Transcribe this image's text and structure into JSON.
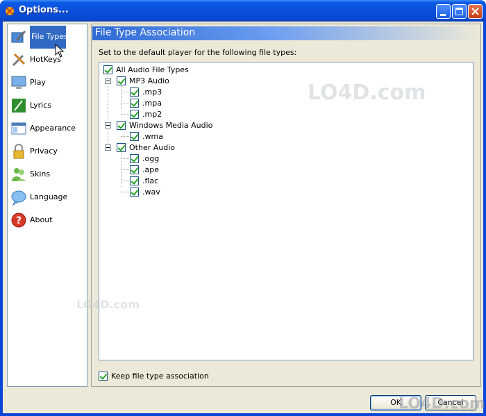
{
  "window": {
    "title": "Options..."
  },
  "nav": {
    "items": [
      {
        "label": "File Types",
        "icon": "file-types-icon",
        "selected": true
      },
      {
        "label": "HotKeys",
        "icon": "hotkeys-icon"
      },
      {
        "label": "Play",
        "icon": "play-icon"
      },
      {
        "label": "Lyrics",
        "icon": "lyrics-icon"
      },
      {
        "label": "Appearance",
        "icon": "appearance-icon"
      },
      {
        "label": "Privacy",
        "icon": "privacy-icon"
      },
      {
        "label": "Skins",
        "icon": "skins-icon"
      },
      {
        "label": "Language",
        "icon": "language-icon"
      },
      {
        "label": "About",
        "icon": "about-icon"
      }
    ]
  },
  "panel": {
    "title": "File Type Association",
    "instruction": "Set to the default player for the following file types:",
    "tree": {
      "root": {
        "label": "All Audio File Types",
        "checked": true
      },
      "groups": [
        {
          "label": "MP3 Audio",
          "checked": true,
          "children": [
            ".mp3",
            ".mpa",
            ".mp2"
          ]
        },
        {
          "label": "Windows Media Audio",
          "checked": true,
          "children": [
            ".wma"
          ]
        },
        {
          "label": "Other Audio",
          "checked": true,
          "children": [
            ".ogg",
            ".ape",
            ".flac",
            ".wav"
          ]
        }
      ]
    },
    "keep_association": {
      "label": "Keep file type association",
      "checked": true
    }
  },
  "buttons": {
    "ok": "OK",
    "cancel": "Cancel"
  },
  "watermark": "LO4D.com",
  "colors": {
    "titlebar": "#0a50dc",
    "selection": "#316ac5",
    "header_gradient_start": "#2e6ad4",
    "check": "#21a121"
  }
}
